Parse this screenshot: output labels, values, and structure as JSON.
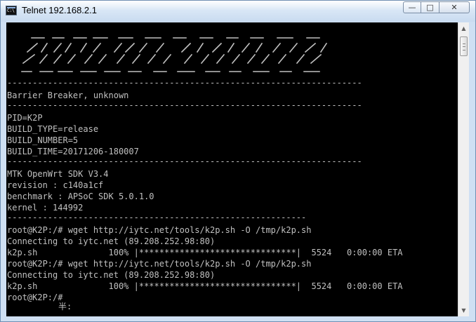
{
  "window": {
    "title": "Telnet 192.168.2.1",
    "controls": {
      "minimize": "—",
      "maximize": "□",
      "close": "✕"
    }
  },
  "console": {
    "lines": [
      "----------------------------------------------------------------------",
      "Barrier Breaker, unknown",
      "----------------------------------------------------------------------",
      "PID=K2P",
      "BUILD_TYPE=release",
      "BUILD_NUMBER=5",
      "BUILD_TIME=20171206-180007",
      "----------------------------------------------------------------------",
      "MTK OpenWrt SDK V3.4",
      "revision : c140a1cf",
      "benchmark : APSoC SDK 5.0.1.0",
      "kernel : 144992",
      "-----------------------------------------------------------",
      "root@K2P:/# wget http://iytc.net/tools/k2p.sh -O /tmp/k2p.sh",
      "Connecting to iytc.net (89.208.252.98:80)",
      "k2p.sh              100% |*******************************|  5524   0:00:00 ETA",
      "root@K2P:/# wget http://iytc.net/tools/k2p.sh -O /tmp/k2p.sh",
      "Connecting to iytc.net (89.208.252.98:80)",
      "k2p.sh              100% |*******************************|  5524   0:00:00 ETA",
      "root@K2P:/#"
    ],
    "cursor_text": "半:"
  },
  "scrollbar": {
    "up_arrow": "▲",
    "down_arrow": "▼"
  }
}
